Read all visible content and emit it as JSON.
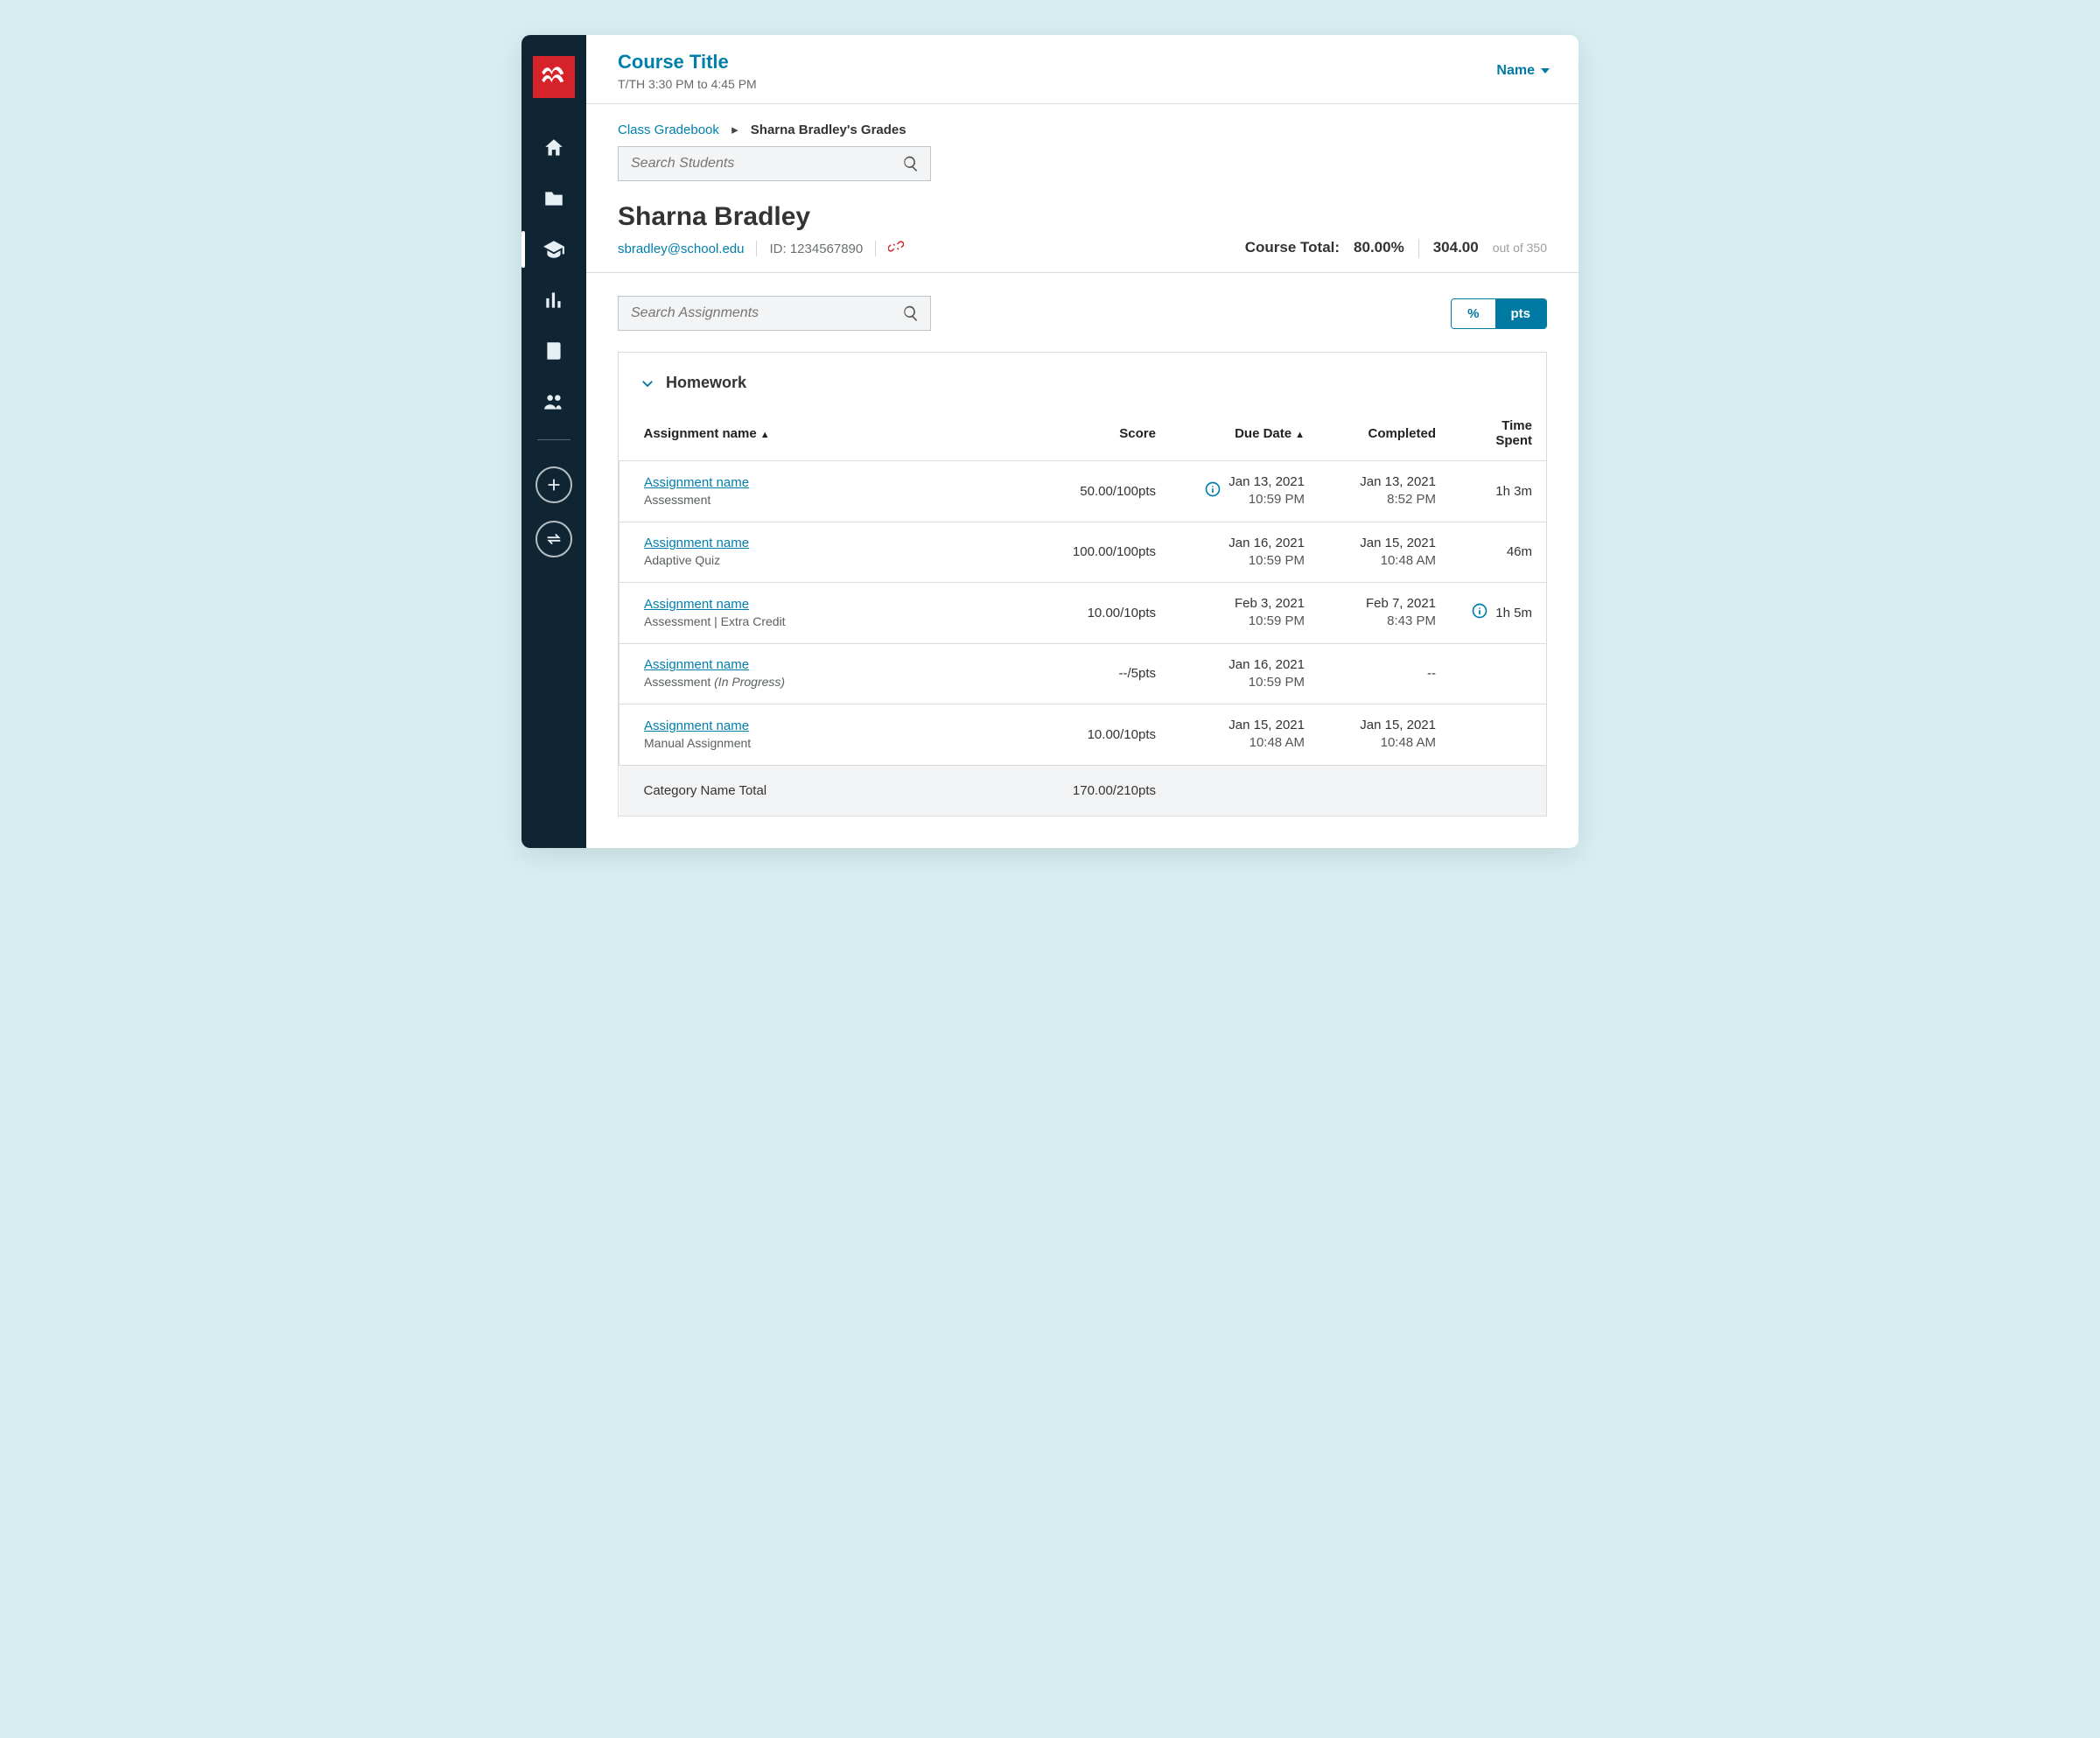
{
  "header": {
    "course_title": "Course Title",
    "course_time": "T/TH 3:30 PM to 4:45 PM",
    "user_label": "Name"
  },
  "breadcrumb": {
    "root": "Class Gradebook",
    "current": "Sharna Bradley's Grades"
  },
  "search_students_placeholder": "Search Students",
  "search_assignments_placeholder": "Search Assignments",
  "student": {
    "name": "Sharna Bradley",
    "email": "sbradley@school.edu",
    "id_label": "ID: 1234567890"
  },
  "totals": {
    "label": "Course Total:",
    "percent": "80.00%",
    "points": "304.00",
    "out_of": "out of 350"
  },
  "toggle": {
    "percent": "%",
    "points": "pts"
  },
  "category": "Homework",
  "columns": {
    "name": "Assignment name",
    "score": "Score",
    "due": "Due Date",
    "completed": "Completed",
    "time": "Time Spent"
  },
  "rows": [
    {
      "name": "Assignment name",
      "type": "Assessment",
      "score": "50.00/100pts",
      "due_date": "Jan 13, 2021",
      "due_time": "10:59 PM",
      "comp_date": "Jan 13, 2021",
      "comp_time": "8:52 PM",
      "time": "1h 3m",
      "due_info": true,
      "time_info": false
    },
    {
      "name": "Assignment name",
      "type": "Adaptive Quiz",
      "score": "100.00/100pts",
      "due_date": "Jan 16, 2021",
      "due_time": "10:59 PM",
      "comp_date": "Jan 15, 2021",
      "comp_time": "10:48 AM",
      "time": "46m",
      "due_info": false,
      "time_info": false
    },
    {
      "name": "Assignment name",
      "type": "Assessment | Extra Credit",
      "score": "10.00/10pts",
      "due_date": "Feb 3, 2021",
      "due_time": "10:59 PM",
      "comp_date": "Feb 7, 2021",
      "comp_time": "8:43 PM",
      "time": "1h 5m",
      "due_info": false,
      "time_info": true
    },
    {
      "name": "Assignment name",
      "type": "Assessment <em>(In Progress)</em>",
      "type_html": true,
      "score": "--/5pts",
      "due_date": "Jan 16, 2021",
      "due_time": "10:59 PM",
      "comp_date": "--",
      "comp_time": "",
      "time": "",
      "due_info": false,
      "time_info": false
    },
    {
      "name": "Assignment name",
      "type": "Manual Assignment",
      "score": "10.00/10pts",
      "due_date": "Jan 15, 2021",
      "due_time": "10:48 AM",
      "comp_date": "Jan 15, 2021",
      "comp_time": "10:48 AM",
      "time": "",
      "due_info": false,
      "time_info": false
    }
  ],
  "footer": {
    "label": "Category Name Total",
    "score": "170.00/210pts"
  }
}
